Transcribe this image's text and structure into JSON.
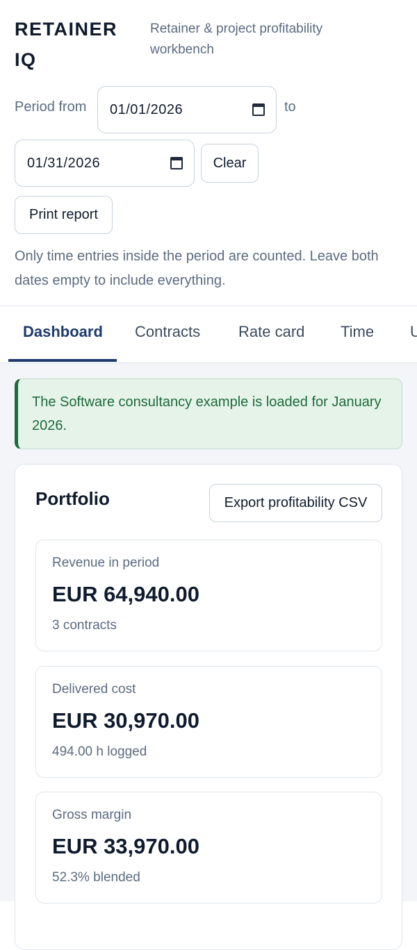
{
  "app": {
    "brand": "RETAINER IQ",
    "tagline": "Retainer & project profitability workbench"
  },
  "period": {
    "from_label": "Period from",
    "from_value": "01/01/2026",
    "to_label": "to",
    "to_value": "01/31/2026",
    "clear_label": "Clear",
    "print_label": "Print report",
    "hint": "Only time entries inside the period are counted. Leave both dates empty to include everything."
  },
  "tabs": [
    {
      "label": "Dashboard",
      "active": true
    },
    {
      "label": "Contracts",
      "active": false
    },
    {
      "label": "Rate card",
      "active": false
    },
    {
      "label": "Time",
      "active": false
    },
    {
      "label": "U",
      "active": false
    }
  ],
  "notice": {
    "text": "The Software consultancy example is loaded for January 2026."
  },
  "portfolio": {
    "title": "Portfolio",
    "export_label": "Export profitability CSV",
    "cards": [
      {
        "label": "Revenue in period",
        "value": "EUR 64,940.00",
        "sub": "3 contracts"
      },
      {
        "label": "Delivered cost",
        "value": "EUR 30,970.00",
        "sub": "494.00 h logged"
      },
      {
        "label": "Gross margin",
        "value": "EUR 33,970.00",
        "sub": "52.3% blended"
      }
    ]
  },
  "colors": {
    "accent": "#1b3a6b",
    "success": "#1d6b3a",
    "success_bg": "#e5f3e9",
    "muted_text": "#5b6b80"
  },
  "icons": {
    "date_picker": "calendar-icon"
  }
}
